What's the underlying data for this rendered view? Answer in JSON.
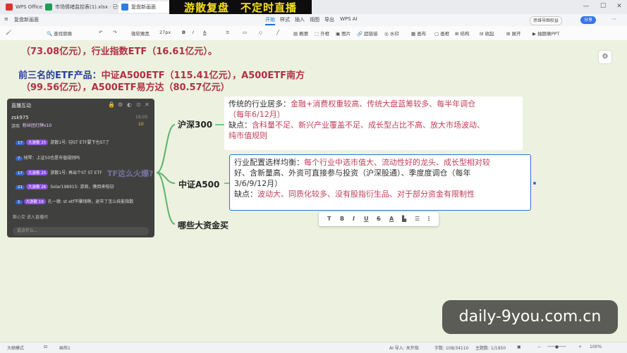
{
  "titlebar": {
    "tabs": [
      {
        "label": "WPS Office",
        "color": "#e0312e"
      },
      {
        "label": "市场情绪监控表(1).xlsx · 已保存",
        "color": "#1f9d55"
      },
      {
        "label": "复盘新画面",
        "color": "#2f7de1"
      }
    ],
    "banner": "游散复盘　不定时直播",
    "window_controls": [
      "minimize-icon",
      "maximize-icon",
      "close-icon"
    ]
  },
  "menubar": {
    "doc_title": "复盘新画面",
    "items": [
      "开始",
      "样式",
      "插入",
      "视图",
      "导出",
      "WPS AI"
    ],
    "active": "开始",
    "ai_badge": "思维导图权益",
    "share_label": "分享"
  },
  "toolbar": {
    "find_replace": "查找替换",
    "font_family": "微软雅黑",
    "font_size": "27px",
    "bold": "B",
    "italic": "I",
    "underline": "U",
    "strike": "S",
    "font_color": "A",
    "items": [
      "概要",
      "外框",
      "图片",
      "超链接",
      "水印",
      "画布",
      "画框",
      "结构",
      "收起",
      "展开",
      "抽题做PPT"
    ]
  },
  "canvas": {
    "top_line": "（73.08亿元），行业指数ETF（16.61亿元）。",
    "line2_blue": "前三名的ETF产品：",
    "line2_red": "中证A500ETF（115.41亿元），A500ETF南方",
    "line3": "（99.56亿元），A500ETF易方达（80.57亿元）"
  },
  "mindmap": {
    "node1": "沪深300",
    "node2": "中证A500",
    "node3": "哪些大资金买",
    "card1": {
      "line1_label": "传统的行业居多：",
      "line1_value": "金融+消费权重较高、传统大盘蓝筹较多、每半年调仓",
      "line2": "（每年6/12月）",
      "line3_label": "缺点：",
      "line3_value": "含科量不足、新兴产业覆盖不足、成长型占比不高、放大市场波动、",
      "line4": "纯市值规则"
    },
    "card2": {
      "line1_label": "行业配置选样均衡：",
      "line1_value": "每个行业中选市值大、流动性好的龙头、成长型相对较",
      "line2": "好、含新量高、外资可直接参与投资（沪深股通）、季度度调仓（每年",
      "line3": "3/6/9/12月）",
      "line4_label": "缺点：",
      "line4_value": "波动大、同质化较多、没有股指衍生品、对于部分资金有限制性"
    },
    "partial_hidden_text": "TF这么火爆?",
    "format_bar": [
      "T",
      "B",
      "I",
      "U",
      "S",
      "A",
      "highlight-icon",
      "list-icon",
      "ordered-list-icon"
    ]
  },
  "chat": {
    "title": "直播互动",
    "user": "zsk975",
    "user_sub": "游商",
    "user_badge": "粉丝团灯牌x10",
    "right_top": "19:05",
    "coin": "10",
    "messages": [
      {
        "level": "17",
        "badge": "大游散 25",
        "text": "游散1号: 🐱ST ETF要下也ST了"
      },
      {
        "level": "7",
        "badge": "",
        "text": "残琴：上证50也是市值规则吗"
      },
      {
        "level": "17",
        "badge": "大游散 25",
        "text": "游散1号: 再出个ST ST ETF"
      },
      {
        "level": "21",
        "badge": "大游散 26",
        "text": "Solar198915: 游商，晚回来啦🐱"
      },
      {
        "level": "1",
        "badge": "大游散 19",
        "text": "孔一德: st etf不赚钱啊，退市了怎么技能指数"
      }
    ],
    "join_text": "斯心交 进入直播间",
    "input_placeholder": "说点什么..."
  },
  "statusbar": {
    "items": [
      "大纲模式",
      "画布1",
      "AI 导入: 关开指",
      "字数: 108/34110",
      "主题数: 1/1950",
      "100%"
    ]
  },
  "watermark": "daily-9you.com.cn"
}
